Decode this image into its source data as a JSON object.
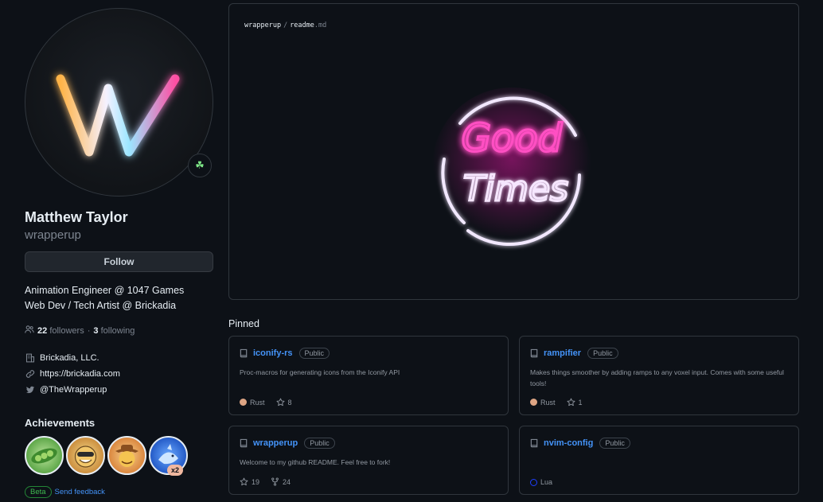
{
  "profile": {
    "name": "Matthew Taylor",
    "login": "wrapperup",
    "follow_label": "Follow",
    "bio_lines": [
      "Animation Engineer @ 1047 Games",
      "Web Dev / Tech Artist @ Brickadia"
    ],
    "followers_count": "22",
    "followers_label": "followers",
    "dot": "·",
    "following_count": "3",
    "following_label": "following",
    "company": "Brickadia, LLC.",
    "website": "https://brickadia.com",
    "twitter": "@TheWrapperup",
    "status_icon": "sprout-icon",
    "avatar_letter": "W"
  },
  "achievements": {
    "title": "Achievements",
    "badges": [
      {
        "name": "pea-pod-badge",
        "color": "#5fa84a"
      },
      {
        "name": "grinning-cat-badge",
        "color": "#e8b04a"
      },
      {
        "name": "cowboy-badge",
        "color": "#d9833a"
      },
      {
        "name": "shark-badge",
        "color": "#2f6fd6"
      }
    ],
    "count": "x2",
    "beta_label": "Beta",
    "feedback_label": "Send feedback"
  },
  "readme": {
    "repo": "wrapperup",
    "separator": "/",
    "file": "readme",
    "ext": ".md",
    "neon_line1": "Good",
    "neon_line2": "Times"
  },
  "pinned": {
    "title": "Pinned",
    "cards": [
      {
        "name": "iconify-rs",
        "visibility": "Public",
        "description": "Proc-macros for generating icons from the Iconify API",
        "language": "Rust",
        "lang_color": "#dea584",
        "stars": "8"
      },
      {
        "name": "rampifier",
        "visibility": "Public",
        "description": "Makes things smoother by adding ramps to any voxel input. Comes with some useful tools!",
        "language": "Rust",
        "lang_color": "#dea584",
        "stars": "1"
      },
      {
        "name": "wrapperup",
        "visibility": "Public",
        "description": "Welcome to my github README. Feel free to fork!",
        "stars": "19",
        "forks": "24"
      },
      {
        "name": "nvim-config",
        "visibility": "Public",
        "description": "",
        "language": "Lua",
        "lang_color": "#000080"
      }
    ]
  }
}
